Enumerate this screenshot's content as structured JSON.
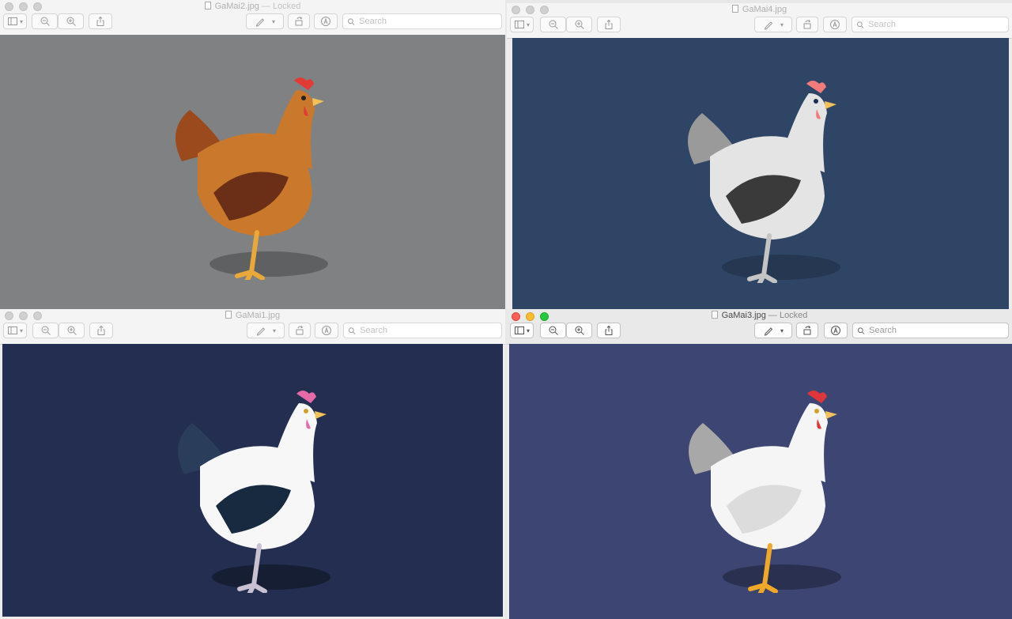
{
  "windows": [
    {
      "id": "w1",
      "filename": "GaMai2.jpg",
      "locked_label": "— Locked",
      "active": false,
      "search_placeholder": "Search",
      "canvas_color": "#7f8183",
      "hen": {
        "body": "#c9782c",
        "wing": "#6b2f17",
        "tail": "#9a4a1d",
        "comb": "#e23a35",
        "legs": "#e8a83a"
      }
    },
    {
      "id": "w2",
      "filename": "GaMai4.jpg",
      "locked_label": "",
      "active": false,
      "search_placeholder": "Search",
      "canvas_color": "#2f4566",
      "hen": {
        "body": "#e4e4e4",
        "wing": "#3a3a3a",
        "tail": "#9a9a9a",
        "comb": "#f27b7b",
        "legs": "#c4c4c4"
      }
    },
    {
      "id": "w3",
      "filename": "GaMai1.jpg",
      "locked_label": "",
      "active": false,
      "search_placeholder": "Search",
      "canvas_color": "#232e50",
      "hen": {
        "body": "#f7f7f7",
        "wing": "#172a40",
        "tail": "#2a3d5a",
        "comb": "#e46aa8",
        "legs": "#c9c0d2"
      }
    },
    {
      "id": "w4",
      "filename": "GaMai3.jpg",
      "locked_label": "— Locked",
      "active": true,
      "search_placeholder": "Search",
      "canvas_color": "#3d4572",
      "hen": {
        "body": "#f5f5f5",
        "wing": "#dcdcdc",
        "tail": "#a8a8a8",
        "comb": "#e0363b",
        "legs": "#f0a828"
      }
    }
  ],
  "toolbar_icons": [
    "sidebar-icon",
    "zoom-out-icon",
    "zoom-in-icon",
    "share-icon",
    "markup-pen-icon",
    "rotate-icon",
    "annotate-icon",
    "search-icon"
  ]
}
